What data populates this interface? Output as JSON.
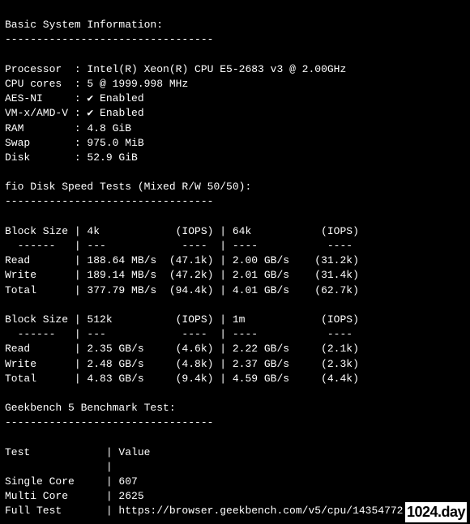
{
  "basicInfo": {
    "title": "Basic System Information:",
    "sep": "---------------------------------",
    "rows": [
      {
        "label": "Processor ",
        "value": "Intel(R) Xeon(R) CPU E5-2683 v3 @ 2.00GHz"
      },
      {
        "label": "CPU cores ",
        "value": "5 @ 1999.998 MHz"
      },
      {
        "label": "AES-NI    ",
        "value": "✔ Enabled"
      },
      {
        "label": "VM-x/AMD-V",
        "value": "✔ Enabled"
      },
      {
        "label": "RAM       ",
        "value": "4.8 GiB"
      },
      {
        "label": "Swap      ",
        "value": "975.0 MiB"
      },
      {
        "label": "Disk      ",
        "value": "52.9 GiB"
      }
    ]
  },
  "fio": {
    "title": "fio Disk Speed Tests (Mixed R/W 50/50):",
    "sep": "---------------------------------",
    "table1": {
      "headerLine": "Block Size | 4k            (IOPS) | 64k           (IOPS)",
      "divLine": "  ------   | ---            ----  | ----           ---- ",
      "rows": [
        "Read       | 188.64 MB/s  (47.1k) | 2.00 GB/s    (31.2k)",
        "Write      | 189.14 MB/s  (47.2k) | 2.01 GB/s    (31.4k)",
        "Total      | 377.79 MB/s  (94.4k) | 4.01 GB/s    (62.7k)"
      ]
    },
    "table2": {
      "headerLine": "Block Size | 512k          (IOPS) | 1m            (IOPS)",
      "divLine": "  ------   | ---            ----  | ----           ---- ",
      "rows": [
        "Read       | 2.35 GB/s     (4.6k) | 2.22 GB/s     (2.1k)",
        "Write      | 2.48 GB/s     (4.8k) | 2.37 GB/s     (2.3k)",
        "Total      | 4.83 GB/s     (9.4k) | 4.59 GB/s     (4.4k)"
      ]
    }
  },
  "geekbench": {
    "title": "Geekbench 5 Benchmark Test:",
    "sep": "---------------------------------",
    "headerLine": "Test            | Value",
    "rows": [
      "                | ",
      "Single Core     | 607",
      "Multi Core      | 2625",
      "Full Test       | https://browser.geekbench.com/v5/cpu/14354772"
    ]
  },
  "watermark": "1024.day"
}
